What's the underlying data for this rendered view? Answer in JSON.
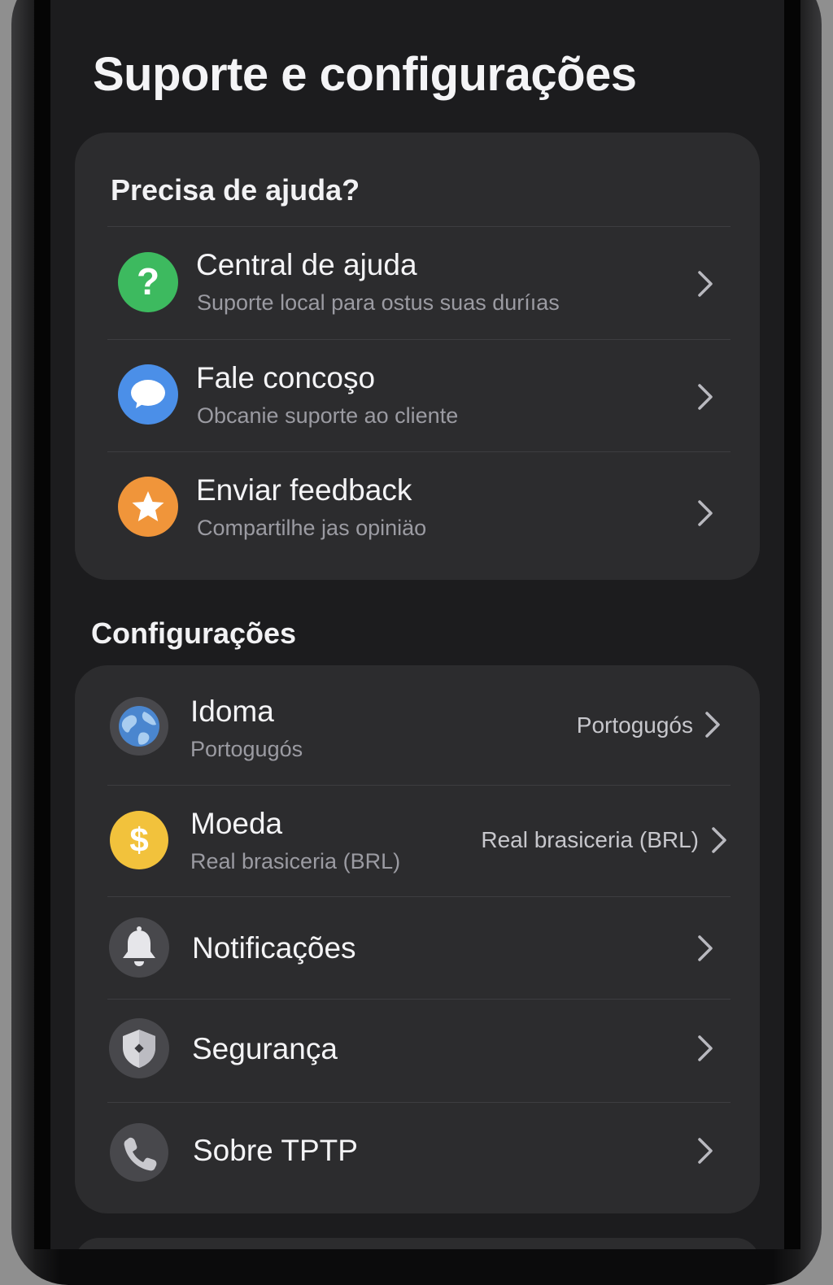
{
  "page": {
    "title": "Suporte e configurações"
  },
  "help": {
    "heading": "Precisa de ajuda?",
    "items": [
      {
        "title": "Central de ajuda",
        "subtitle": "Suporte local para ostus suas duríıas",
        "icon": "question-icon",
        "color": "#3dba5f"
      },
      {
        "title": "Fale concoşo",
        "subtitle": "Obcanie suporte ao cliente",
        "icon": "chat-bubble-icon",
        "color": "#4b8fe8"
      },
      {
        "title": "Enviar feedback",
        "subtitle": "Compartilhe jas opiniäo",
        "icon": "star-icon",
        "color": "#f0953a"
      }
    ]
  },
  "settings": {
    "heading": "Configurações",
    "items": [
      {
        "title": "Idoma",
        "subtitle": "Portogugós",
        "value": "Portogugós",
        "icon": "globe-icon"
      },
      {
        "title": "Moeda",
        "subtitle": "Real brasiceria (BRL)",
        "value": "Real brasiceria (BRL)",
        "icon": "dollar-icon",
        "color": "#f2c23c"
      },
      {
        "title": "Notificações",
        "icon": "bell-icon"
      },
      {
        "title": "Segurança",
        "icon": "shield-icon"
      },
      {
        "title": "Sobre TPTP",
        "icon": "phone-icon"
      }
    ]
  }
}
